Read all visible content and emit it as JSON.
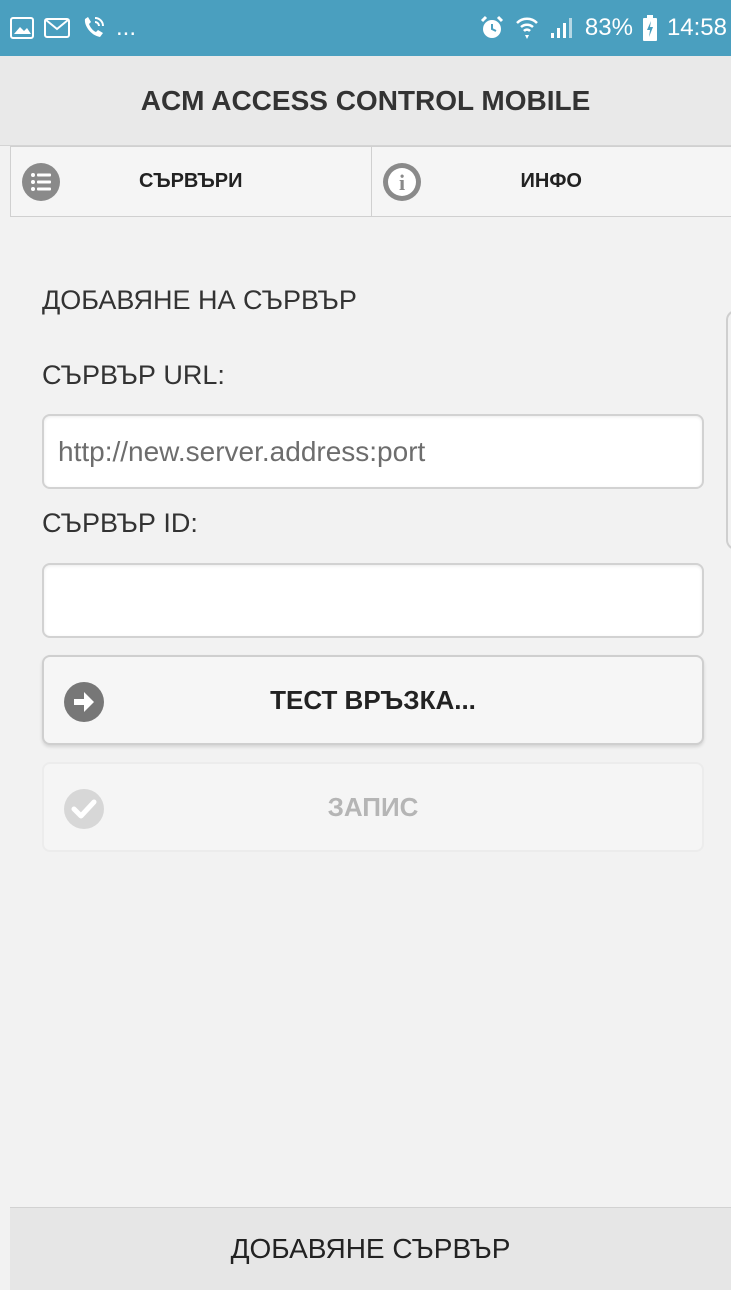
{
  "status_bar": {
    "left_icons": [
      "image-icon",
      "gmail-icon",
      "phone-wifi-call-icon"
    ],
    "more": "...",
    "right_icons": [
      "alarm-icon",
      "wifi-icon",
      "signal-icon"
    ],
    "battery_percent": "83%",
    "time": "14:58",
    "bar_color": "#4a9fbf"
  },
  "header": {
    "title": "ACM ACCESS CONTROL MOBILE"
  },
  "tabs": [
    {
      "label": "СЪРВЪРИ",
      "icon": "list-icon"
    },
    {
      "label": "ИНФО",
      "icon": "info-icon"
    }
  ],
  "form": {
    "section_title": "ДОБАВЯНЕ НА СЪРВЪР",
    "url_label": "СЪРВЪР URL:",
    "url_placeholder": "http://new.server.address:port",
    "url_value": "",
    "id_label": "СЪРВЪР ID:",
    "id_value": ""
  },
  "buttons": {
    "test_label": "ТЕСТ ВРЪЗКА...",
    "test_icon": "arrow-right-circle-icon",
    "save_label": "ЗАПИС",
    "save_icon": "check-circle-icon",
    "save_disabled": true
  },
  "footer": {
    "add_server_label": "ДОБАВЯНЕ СЪРВЪР"
  }
}
